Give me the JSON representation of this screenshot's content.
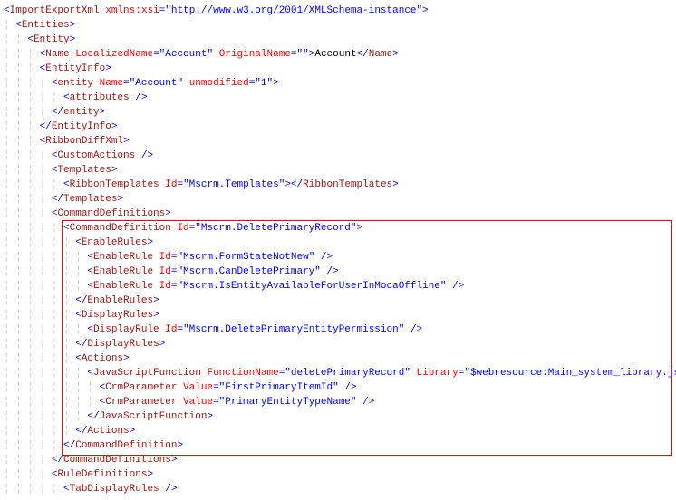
{
  "lines": [
    {
      "indent": 0,
      "parts": [
        {
          "t": "brk",
          "v": "<"
        },
        {
          "t": "elem",
          "v": "ImportExportXml"
        },
        {
          "t": "txt",
          "v": " "
        },
        {
          "t": "attr",
          "v": "xmlns:xsi"
        },
        {
          "t": "brk",
          "v": "="
        },
        {
          "t": "brk",
          "v": "\""
        },
        {
          "t": "val-link",
          "v": "http://www.w3.org/2001/XMLSchema-instance"
        },
        {
          "t": "brk",
          "v": "\""
        },
        {
          "t": "brk",
          "v": ">"
        }
      ]
    },
    {
      "indent": 1,
      "parts": [
        {
          "t": "brk",
          "v": "<"
        },
        {
          "t": "elem",
          "v": "Entities"
        },
        {
          "t": "brk",
          "v": ">"
        }
      ]
    },
    {
      "indent": 2,
      "parts": [
        {
          "t": "brk",
          "v": "<"
        },
        {
          "t": "elem",
          "v": "Entity"
        },
        {
          "t": "brk",
          "v": ">"
        }
      ]
    },
    {
      "indent": 3,
      "parts": [
        {
          "t": "brk",
          "v": "<"
        },
        {
          "t": "elem",
          "v": "Name"
        },
        {
          "t": "txt",
          "v": " "
        },
        {
          "t": "attr",
          "v": "LocalizedName"
        },
        {
          "t": "brk",
          "v": "=\""
        },
        {
          "t": "val",
          "v": "Account"
        },
        {
          "t": "brk",
          "v": "\""
        },
        {
          "t": "txt",
          "v": " "
        },
        {
          "t": "attr",
          "v": "OriginalName"
        },
        {
          "t": "brk",
          "v": "=\""
        },
        {
          "t": "val",
          "v": ""
        },
        {
          "t": "brk",
          "v": "\""
        },
        {
          "t": "brk",
          "v": ">"
        },
        {
          "t": "txt",
          "v": "Account"
        },
        {
          "t": "brk",
          "v": "</"
        },
        {
          "t": "elem",
          "v": "Name"
        },
        {
          "t": "brk",
          "v": ">"
        }
      ]
    },
    {
      "indent": 3,
      "parts": [
        {
          "t": "brk",
          "v": "<"
        },
        {
          "t": "elem",
          "v": "EntityInfo"
        },
        {
          "t": "brk",
          "v": ">"
        }
      ]
    },
    {
      "indent": 4,
      "parts": [
        {
          "t": "brk",
          "v": "<"
        },
        {
          "t": "elem",
          "v": "entity"
        },
        {
          "t": "txt",
          "v": " "
        },
        {
          "t": "attr",
          "v": "Name"
        },
        {
          "t": "brk",
          "v": "=\""
        },
        {
          "t": "val",
          "v": "Account"
        },
        {
          "t": "brk",
          "v": "\""
        },
        {
          "t": "txt",
          "v": " "
        },
        {
          "t": "attr",
          "v": "unmodified"
        },
        {
          "t": "brk",
          "v": "=\""
        },
        {
          "t": "val",
          "v": "1"
        },
        {
          "t": "brk",
          "v": "\""
        },
        {
          "t": "brk",
          "v": ">"
        }
      ]
    },
    {
      "indent": 5,
      "parts": [
        {
          "t": "brk",
          "v": "<"
        },
        {
          "t": "elem",
          "v": "attributes"
        },
        {
          "t": "txt",
          "v": " "
        },
        {
          "t": "brk",
          "v": "/>"
        }
      ]
    },
    {
      "indent": 4,
      "parts": [
        {
          "t": "brk",
          "v": "</"
        },
        {
          "t": "elem",
          "v": "entity"
        },
        {
          "t": "brk",
          "v": ">"
        }
      ]
    },
    {
      "indent": 3,
      "parts": [
        {
          "t": "brk",
          "v": "</"
        },
        {
          "t": "elem",
          "v": "EntityInfo"
        },
        {
          "t": "brk",
          "v": ">"
        }
      ]
    },
    {
      "indent": 3,
      "parts": [
        {
          "t": "brk",
          "v": "<"
        },
        {
          "t": "elem",
          "v": "RibbonDiffXml"
        },
        {
          "t": "brk",
          "v": ">"
        }
      ]
    },
    {
      "indent": 4,
      "parts": [
        {
          "t": "brk",
          "v": "<"
        },
        {
          "t": "elem",
          "v": "CustomActions"
        },
        {
          "t": "txt",
          "v": " "
        },
        {
          "t": "brk",
          "v": "/>"
        }
      ]
    },
    {
      "indent": 4,
      "parts": [
        {
          "t": "brk",
          "v": "<"
        },
        {
          "t": "elem",
          "v": "Templates"
        },
        {
          "t": "brk",
          "v": ">"
        }
      ]
    },
    {
      "indent": 5,
      "parts": [
        {
          "t": "brk",
          "v": "<"
        },
        {
          "t": "elem",
          "v": "RibbonTemplates"
        },
        {
          "t": "txt",
          "v": " "
        },
        {
          "t": "attr",
          "v": "Id"
        },
        {
          "t": "brk",
          "v": "=\""
        },
        {
          "t": "val",
          "v": "Mscrm.Templates"
        },
        {
          "t": "brk",
          "v": "\""
        },
        {
          "t": "brk",
          "v": ">"
        },
        {
          "t": "brk",
          "v": "</"
        },
        {
          "t": "elem",
          "v": "RibbonTemplates"
        },
        {
          "t": "brk",
          "v": ">"
        }
      ]
    },
    {
      "indent": 4,
      "parts": [
        {
          "t": "brk",
          "v": "</"
        },
        {
          "t": "elem",
          "v": "Templates"
        },
        {
          "t": "brk",
          "v": ">"
        }
      ]
    },
    {
      "indent": 4,
      "parts": [
        {
          "t": "brk",
          "v": "<"
        },
        {
          "t": "elem",
          "v": "CommandDefinitions"
        },
        {
          "t": "brk",
          "v": ">"
        }
      ]
    },
    {
      "indent": 5,
      "parts": [
        {
          "t": "brk",
          "v": "<"
        },
        {
          "t": "elem",
          "v": "CommandDefinition"
        },
        {
          "t": "txt",
          "v": " "
        },
        {
          "t": "attr",
          "v": "Id"
        },
        {
          "t": "brk",
          "v": "=\""
        },
        {
          "t": "val",
          "v": "Mscrm.DeletePrimaryRecord"
        },
        {
          "t": "brk",
          "v": "\""
        },
        {
          "t": "brk",
          "v": ">"
        }
      ]
    },
    {
      "indent": 6,
      "parts": [
        {
          "t": "brk",
          "v": "<"
        },
        {
          "t": "elem",
          "v": "EnableRules"
        },
        {
          "t": "brk",
          "v": ">"
        }
      ]
    },
    {
      "indent": 7,
      "parts": [
        {
          "t": "brk",
          "v": "<"
        },
        {
          "t": "elem",
          "v": "EnableRule"
        },
        {
          "t": "txt",
          "v": " "
        },
        {
          "t": "attr",
          "v": "Id"
        },
        {
          "t": "brk",
          "v": "=\""
        },
        {
          "t": "val",
          "v": "Mscrm.FormStateNotNew"
        },
        {
          "t": "brk",
          "v": "\""
        },
        {
          "t": "txt",
          "v": " "
        },
        {
          "t": "brk",
          "v": "/>"
        }
      ]
    },
    {
      "indent": 7,
      "parts": [
        {
          "t": "brk",
          "v": "<"
        },
        {
          "t": "elem",
          "v": "EnableRule"
        },
        {
          "t": "txt",
          "v": " "
        },
        {
          "t": "attr",
          "v": "Id"
        },
        {
          "t": "brk",
          "v": "=\""
        },
        {
          "t": "val",
          "v": "Mscrm.CanDeletePrimary"
        },
        {
          "t": "brk",
          "v": "\""
        },
        {
          "t": "txt",
          "v": " "
        },
        {
          "t": "brk",
          "v": "/>"
        }
      ]
    },
    {
      "indent": 7,
      "parts": [
        {
          "t": "brk",
          "v": "<"
        },
        {
          "t": "elem",
          "v": "EnableRule"
        },
        {
          "t": "txt",
          "v": " "
        },
        {
          "t": "attr",
          "v": "Id"
        },
        {
          "t": "brk",
          "v": "=\""
        },
        {
          "t": "val",
          "v": "Mscrm.IsEntityAvailableForUserInMocaOffline"
        },
        {
          "t": "brk",
          "v": "\""
        },
        {
          "t": "txt",
          "v": " "
        },
        {
          "t": "brk",
          "v": "/>"
        }
      ]
    },
    {
      "indent": 6,
      "parts": [
        {
          "t": "brk",
          "v": "</"
        },
        {
          "t": "elem",
          "v": "EnableRules"
        },
        {
          "t": "brk",
          "v": ">"
        }
      ]
    },
    {
      "indent": 6,
      "parts": [
        {
          "t": "brk",
          "v": "<"
        },
        {
          "t": "elem",
          "v": "DisplayRules"
        },
        {
          "t": "brk",
          "v": ">"
        }
      ]
    },
    {
      "indent": 7,
      "parts": [
        {
          "t": "brk",
          "v": "<"
        },
        {
          "t": "elem",
          "v": "DisplayRule"
        },
        {
          "t": "txt",
          "v": " "
        },
        {
          "t": "attr",
          "v": "Id"
        },
        {
          "t": "brk",
          "v": "=\""
        },
        {
          "t": "val",
          "v": "Mscrm.DeletePrimaryEntityPermission"
        },
        {
          "t": "brk",
          "v": "\""
        },
        {
          "t": "txt",
          "v": " "
        },
        {
          "t": "brk",
          "v": "/>"
        }
      ]
    },
    {
      "indent": 6,
      "parts": [
        {
          "t": "brk",
          "v": "</"
        },
        {
          "t": "elem",
          "v": "DisplayRules"
        },
        {
          "t": "brk",
          "v": ">"
        }
      ]
    },
    {
      "indent": 6,
      "parts": [
        {
          "t": "brk",
          "v": "<"
        },
        {
          "t": "elem",
          "v": "Actions"
        },
        {
          "t": "brk",
          "v": ">"
        }
      ]
    },
    {
      "indent": 7,
      "parts": [
        {
          "t": "brk",
          "v": "<"
        },
        {
          "t": "elem",
          "v": "JavaScriptFunction"
        },
        {
          "t": "txt",
          "v": " "
        },
        {
          "t": "attr",
          "v": "FunctionName"
        },
        {
          "t": "brk",
          "v": "=\""
        },
        {
          "t": "val",
          "v": "deletePrimaryRecord"
        },
        {
          "t": "brk",
          "v": "\""
        },
        {
          "t": "txt",
          "v": " "
        },
        {
          "t": "attr",
          "v": "Library"
        },
        {
          "t": "brk",
          "v": "=\""
        },
        {
          "t": "val",
          "v": "$webresource:Main_system_library.js"
        },
        {
          "t": "brk",
          "v": "\""
        },
        {
          "t": "brk",
          "v": ">"
        }
      ]
    },
    {
      "indent": 8,
      "parts": [
        {
          "t": "brk",
          "v": "<"
        },
        {
          "t": "elem",
          "v": "CrmParameter"
        },
        {
          "t": "txt",
          "v": " "
        },
        {
          "t": "attr",
          "v": "Value"
        },
        {
          "t": "brk",
          "v": "=\""
        },
        {
          "t": "val",
          "v": "FirstPrimaryItemId"
        },
        {
          "t": "brk",
          "v": "\""
        },
        {
          "t": "txt",
          "v": " "
        },
        {
          "t": "brk",
          "v": "/>"
        }
      ]
    },
    {
      "indent": 8,
      "parts": [
        {
          "t": "brk",
          "v": "<"
        },
        {
          "t": "elem",
          "v": "CrmParameter"
        },
        {
          "t": "txt",
          "v": " "
        },
        {
          "t": "attr",
          "v": "Value"
        },
        {
          "t": "brk",
          "v": "=\""
        },
        {
          "t": "val",
          "v": "PrimaryEntityTypeName"
        },
        {
          "t": "brk",
          "v": "\""
        },
        {
          "t": "txt",
          "v": " "
        },
        {
          "t": "brk",
          "v": "/>"
        }
      ]
    },
    {
      "indent": 7,
      "parts": [
        {
          "t": "brk",
          "v": "</"
        },
        {
          "t": "elem",
          "v": "JavaScriptFunction"
        },
        {
          "t": "brk",
          "v": ">"
        }
      ]
    },
    {
      "indent": 6,
      "parts": [
        {
          "t": "brk",
          "v": "</"
        },
        {
          "t": "elem",
          "v": "Actions"
        },
        {
          "t": "brk",
          "v": ">"
        }
      ]
    },
    {
      "indent": 5,
      "parts": [
        {
          "t": "brk",
          "v": "</"
        },
        {
          "t": "elem",
          "v": "CommandDefinition"
        },
        {
          "t": "brk",
          "v": ">"
        }
      ]
    },
    {
      "indent": 4,
      "parts": [
        {
          "t": "brk",
          "v": "</"
        },
        {
          "t": "elem",
          "v": "CommandDefinitions"
        },
        {
          "t": "brk",
          "v": ">"
        }
      ]
    },
    {
      "indent": 4,
      "parts": [
        {
          "t": "brk",
          "v": "<"
        },
        {
          "t": "elem",
          "v": "RuleDefinitions"
        },
        {
          "t": "brk",
          "v": ">"
        }
      ]
    },
    {
      "indent": 5,
      "parts": [
        {
          "t": "brk",
          "v": "<"
        },
        {
          "t": "elem",
          "v": "TabDisplayRules"
        },
        {
          "t": "txt",
          "v": " "
        },
        {
          "t": "brk",
          "v": "/>"
        }
      ]
    }
  ],
  "highlight": {
    "startLine": 15,
    "endLine": 30
  }
}
